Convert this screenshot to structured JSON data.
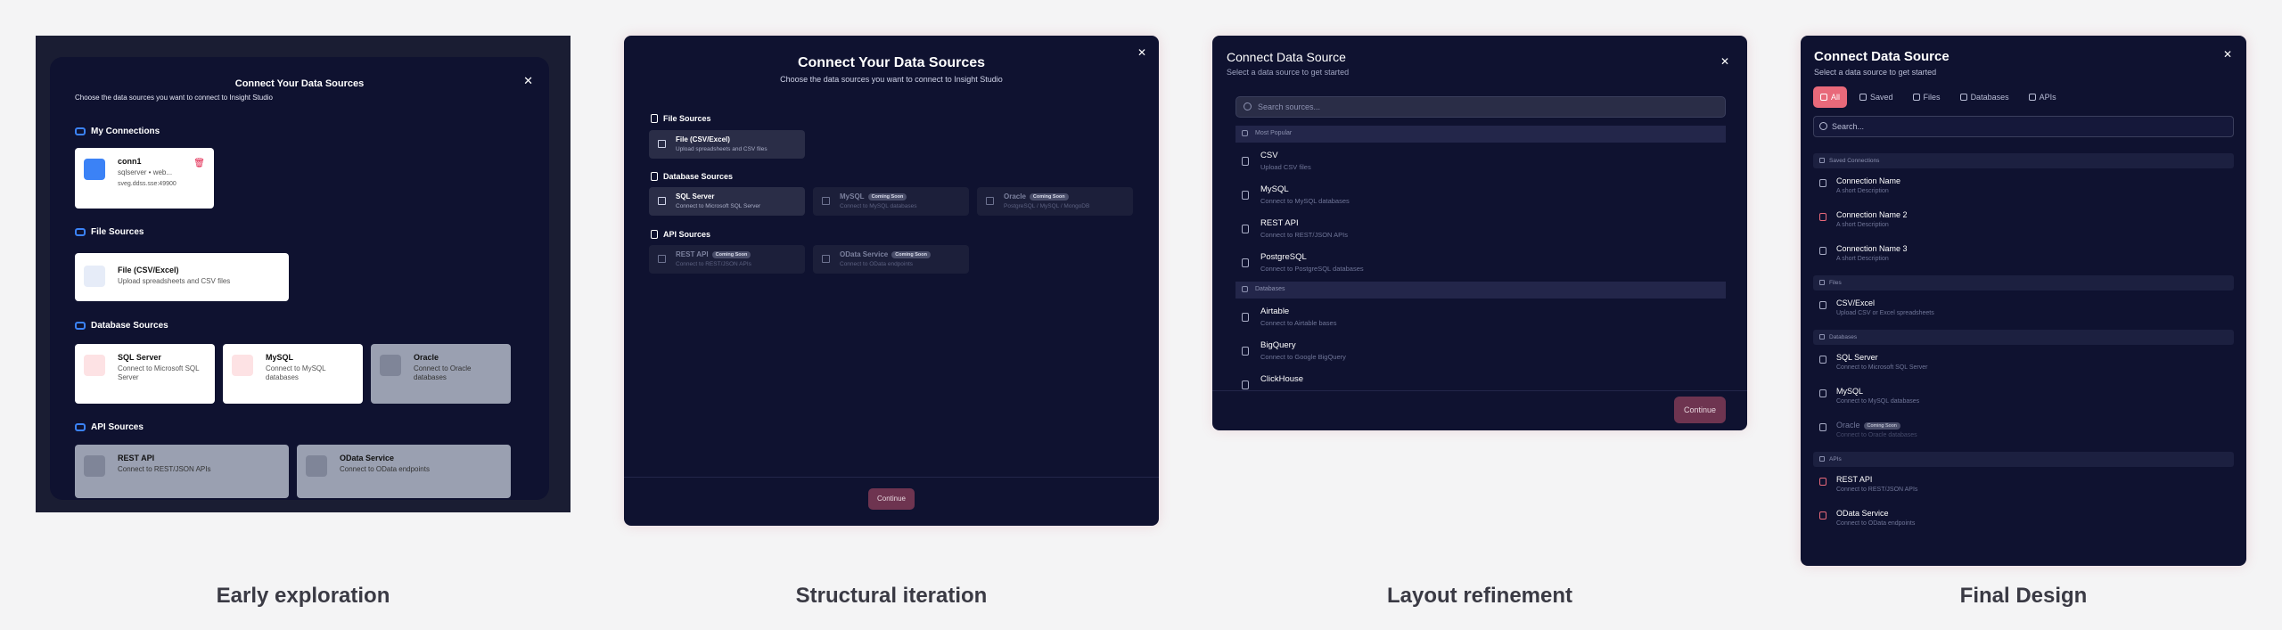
{
  "captions": [
    "Early exploration",
    "Structural iteration",
    "Layout refinement",
    "Final Design"
  ],
  "p1": {
    "title": "Connect Your Data Sources",
    "subtitle": "Choose the data sources you want to connect to Insight Studio",
    "my_connections": "My Connections",
    "conn": {
      "name": "conn1",
      "line1": "sqlserver • web...",
      "line2": "sveg.ddss.sse:49900"
    },
    "file_sources": "File Sources",
    "file": {
      "title": "File (CSV/Excel)",
      "desc": "Upload spreadsheets and CSV files"
    },
    "database_sources": "Database Sources",
    "dbs": [
      {
        "title": "SQL Server",
        "desc": "Connect to Microsoft SQL Server"
      },
      {
        "title": "MySQL",
        "desc": "Connect to MySQL databases"
      },
      {
        "title": "Oracle",
        "desc": "Connect to Oracle databases"
      }
    ],
    "api_sources": "API Sources",
    "apis": [
      {
        "title": "REST API",
        "desc": "Connect to REST/JSON APIs"
      },
      {
        "title": "OData Service",
        "desc": "Connect to OData endpoints"
      }
    ]
  },
  "p2": {
    "title": "Connect Your Data Sources",
    "subtitle": "Choose the data sources you want to connect to Insight Studio",
    "file_sources": "File Sources",
    "file": {
      "title": "File (CSV/Excel)",
      "desc": "Upload spreadsheets and CSV files"
    },
    "database_sources": "Database Sources",
    "dbs": [
      {
        "title": "SQL Server",
        "desc": "Connect to Microsoft SQL Server"
      },
      {
        "title": "MySQL",
        "desc": "Connect to MySQL databases"
      },
      {
        "title": "Oracle",
        "desc": "PostgreSQL / MySQL / MongoDB"
      }
    ],
    "api_sources": "API Sources",
    "apis": [
      {
        "title": "REST API",
        "desc": "Connect to REST/JSON APIs"
      },
      {
        "title": "OData Service",
        "desc": "Connect to OData endpoints"
      }
    ],
    "coming_soon": "Coming Soon",
    "continue": "Continue"
  },
  "p3": {
    "title": "Connect Data Source",
    "subtitle": "Select a data source to get started",
    "search_placeholder": "Search sources...",
    "most_popular": "Most Popular",
    "popular": [
      {
        "title": "CSV",
        "desc": "Upload CSV files"
      },
      {
        "title": "MySQL",
        "desc": "Connect to MySQL databases"
      },
      {
        "title": "REST API",
        "desc": "Connect to REST/JSON APIs"
      },
      {
        "title": "PostgreSQL",
        "desc": "Connect to PostgreSQL databases"
      }
    ],
    "databases": "Databases",
    "dbs": [
      {
        "title": "Airtable",
        "desc": "Connect to Airtable bases"
      },
      {
        "title": "BigQuery",
        "desc": "Connect to Google BigQuery"
      },
      {
        "title": "ClickHouse",
        "desc": ""
      }
    ],
    "continue": "Continue"
  },
  "p4": {
    "title": "Connect Data Source",
    "subtitle": "Select a data source to get started",
    "tabs": [
      "All",
      "Saved",
      "Files",
      "Databases",
      "APIs"
    ],
    "search_placeholder": "Search...",
    "saved_header": "Saved Connections",
    "saved": [
      {
        "title": "Connection Name",
        "desc": "A short Description"
      },
      {
        "title": "Connection Name 2",
        "desc": "A short Description"
      },
      {
        "title": "Connection Name 3",
        "desc": "A short Description"
      }
    ],
    "files_header": "Files",
    "files": [
      {
        "title": "CSV/Excel",
        "desc": "Upload CSV or Excel spreadsheets"
      }
    ],
    "databases_header": "Databases",
    "dbs": [
      {
        "title": "SQL Server",
        "desc": "Connect to Microsoft SQL Server"
      },
      {
        "title": "MySQL",
        "desc": "Connect to MySQL databases"
      },
      {
        "title": "Oracle",
        "desc": "Connect to Oracle databases"
      }
    ],
    "coming_soon": "Coming Soon",
    "apis_header": "APIs",
    "apis": [
      {
        "title": "REST API",
        "desc": "Connect to REST/JSON APIs"
      },
      {
        "title": "OData Service",
        "desc": "Connect to OData endpoints"
      }
    ]
  }
}
